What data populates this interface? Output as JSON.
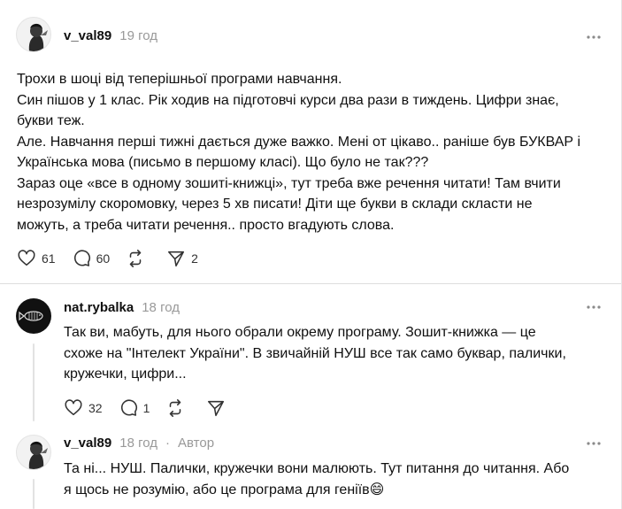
{
  "posts": [
    {
      "username": "v_val89",
      "time": "19 год",
      "lines": [
        "Трохи в шоці від теперішньої програми навчання.",
        "Син пішов у 1 клас. Рік ходив на підготовчі курси два рази в тиждень. Цифри знає,",
        "букви теж.",
        "Але. Навчання перші тижні дається дуже важко. Мені от цікаво.. раніше був БУКВАР і",
        "Українська мова (письмо в першому класі). Що було не так???",
        "Зараз оце «все в одному зошиті-книжці», тут треба вже речення читати! Там вчити",
        "незрозумілу скоромовку, через 5 хв писати! Діти ще букви в склади скласти не",
        "можуть, а треба читати речення.. просто вгадують слова."
      ],
      "likes": "61",
      "replies": "60",
      "reposts": "",
      "shares": "2"
    },
    {
      "username": "nat.rybalka",
      "time": "18 год",
      "lines": [
        "Так ви, мабуть, для нього обрали окрему програму. Зошит-книжка — це",
        "схоже на \"Інтелект України\". В звичайній НУШ все так само буквар, палички,",
        "кружечки, цифри..."
      ],
      "likes": "32",
      "replies": "1",
      "reposts": "",
      "shares": ""
    },
    {
      "username": "v_val89",
      "time": "18 год",
      "author_label": "Автор",
      "lines": [
        "Та ні... НУШ. Палички, кружечки вони малюють. Тут питання до читання. Або",
        "я щось не розумію, або це програма для геніїв😄"
      ]
    }
  ],
  "separator": "·",
  "icons": {
    "like": "heart-icon",
    "reply": "speech-bubble-icon",
    "repost": "repost-icon",
    "share": "send-icon",
    "more": "more-icon"
  }
}
